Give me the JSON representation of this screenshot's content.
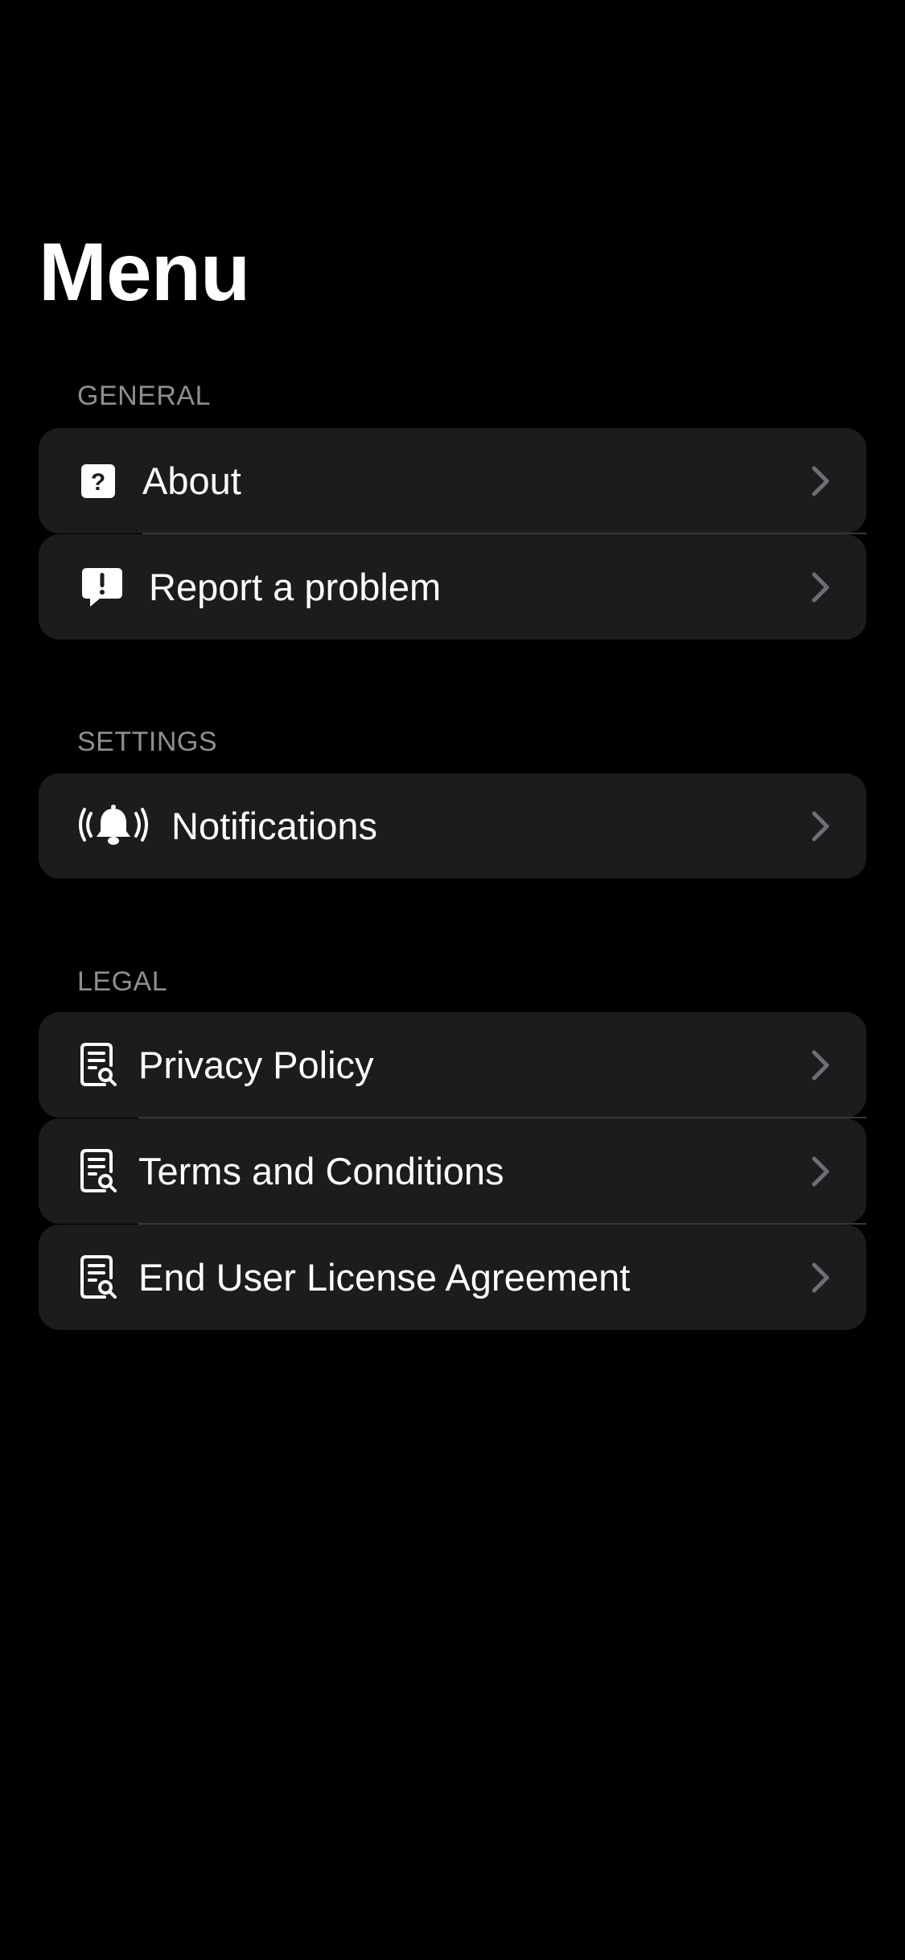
{
  "page": {
    "title": "Menu"
  },
  "sections": {
    "general": {
      "header": "GENERAL",
      "items": [
        {
          "label": "About",
          "icon": "question-square-icon"
        },
        {
          "label": "Report a problem",
          "icon": "exclamation-bubble-icon"
        }
      ]
    },
    "settings": {
      "header": "SETTINGS",
      "items": [
        {
          "label": "Notifications",
          "icon": "bell-ringing-icon"
        }
      ]
    },
    "legal": {
      "header": "LEGAL",
      "items": [
        {
          "label": "Privacy Policy",
          "icon": "document-search-icon"
        },
        {
          "label": "Terms and Conditions",
          "icon": "document-search-icon"
        },
        {
          "label": "End User License Agreement",
          "icon": "document-search-icon"
        }
      ]
    }
  },
  "colors": {
    "background": "#000000",
    "row_background": "#1c1c1e",
    "section_header": "#8e8e93",
    "chevron": "#6e6e73",
    "text": "#ffffff"
  }
}
